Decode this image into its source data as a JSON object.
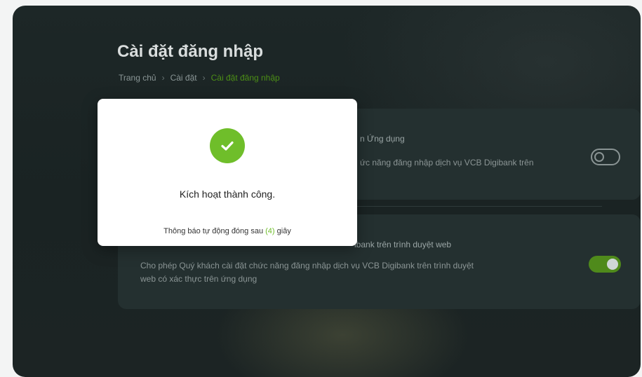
{
  "page": {
    "title": "Cài đặt đăng nhập",
    "breadcrumb": [
      "Trang chủ",
      "Cài đặt",
      "Cài đặt đăng nhập"
    ],
    "breadcrumb_separator": "›"
  },
  "cards": [
    {
      "title": "n Ứng dụng",
      "description": "ức năng đăng nhập dịch vụ VCB Digibank trên",
      "toggle_on": false
    },
    {
      "title": "ibank trên trình duyệt web",
      "description_line1": "Cho phép Quý khách cài đặt chức năng đăng nhập dịch vụ VCB Digibank trên trình duyệt",
      "description_line2": "web có xác thực trên ứng dụng",
      "toggle_on": true
    }
  ],
  "modal": {
    "icon": "check-circle-icon",
    "message": "Kích hoạt thành công.",
    "auto_close_prefix": "Thông báo tự động đóng sau",
    "auto_close_count": "(4)",
    "auto_close_suffix": "giây"
  },
  "colors": {
    "accent_green": "#6fbe2a",
    "toggle_on": "#4f8a1b",
    "breadcrumb_active": "#4c8f16"
  }
}
